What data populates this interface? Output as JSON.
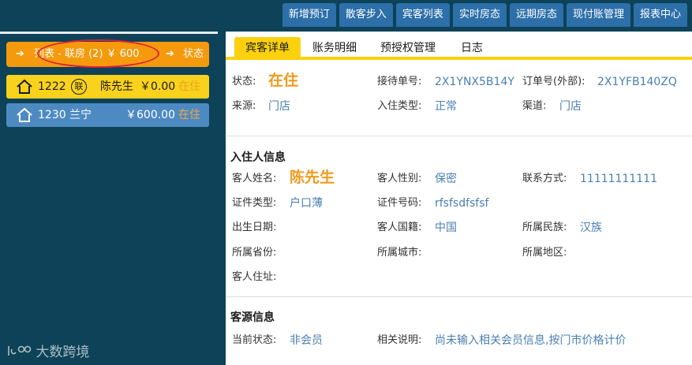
{
  "topnav": [
    "新增预订",
    "散客步入",
    "宾客列表",
    "实时房态",
    "远期房态",
    "现付账管理",
    "报表中心"
  ],
  "room_list": {
    "header": {
      "label": "列表 - 联房 (2) ￥ 600",
      "status": "状态"
    },
    "rooms": [
      {
        "number": "1222",
        "badge": "联",
        "guest": "陈先生",
        "amount": "￥0.00",
        "state": "在住"
      },
      {
        "number": "1230",
        "guest": "兰宁",
        "amount": "￥600.00",
        "state": "在住"
      }
    ]
  },
  "watermark": "大数跨境",
  "tabs": [
    "宾客详单",
    "账务明细",
    "预授权管理",
    "日志"
  ],
  "summary": {
    "status_label": "状态:",
    "status_value": "在住",
    "reception_no_label": "接待单号:",
    "reception_no_value": "2X1YNX5B14Y",
    "order_no_label": "订单号(外部):",
    "order_no_value": "2X1YFB140ZQ",
    "source_label": "来源:",
    "source_value": "门店",
    "checkin_type_label": "入住类型:",
    "checkin_type_value": "正常",
    "channel_label": "渠道:",
    "channel_value": "门店"
  },
  "guest_info": {
    "title": "入住人信息",
    "name_label": "客人姓名:",
    "name_value": "陈先生",
    "gender_label": "客人性别:",
    "gender_value": "保密",
    "contact_label": "联系方式:",
    "contact_value": "11111111111",
    "id_type_label": "证件类型:",
    "id_type_value": "户口薄",
    "id_no_label": "证件号码:",
    "id_no_value": "rfsfsdfsfsf",
    "birth_label": "出生日期:",
    "nationality_label": "客人国籍:",
    "nationality_value": "中国",
    "ethnicity_label": "所属民族:",
    "ethnicity_value": "汉族",
    "province_label": "所属省份:",
    "city_label": "所属城市:",
    "district_label": "所属地区:",
    "address_label": "客人住址:"
  },
  "source_info": {
    "title": "客源信息",
    "member_status_label": "当前状态:",
    "member_status_value": "非会员",
    "note_label": "相关说明:",
    "note_value": "尚未输入相关会员信息,按门市价格计价"
  },
  "colors": {
    "accent_orange": "#f49a0c",
    "tab_yellow": "#fbd10e",
    "nav_blue": "#2d6fa8",
    "bg_dark": "#0d4258"
  }
}
